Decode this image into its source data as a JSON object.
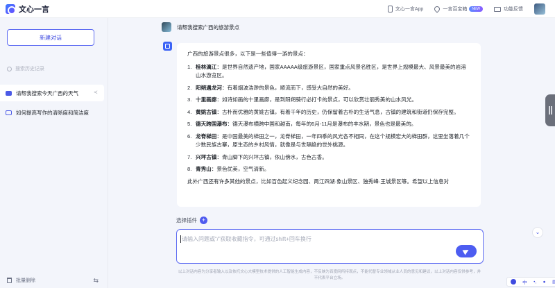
{
  "app": {
    "title": "文心一言"
  },
  "top_links": {
    "app_label": "文心一言App",
    "treasure_label": "一言百宝箱",
    "new_badge": "NEW",
    "feedback_label": "功能反馈"
  },
  "sidebar": {
    "new_chat": "新建对话",
    "search_placeholder": "搜索历史记录",
    "conversations": [
      {
        "title": "请帮我搜索今天广西的天气",
        "active": true
      },
      {
        "title": "如何提高写作的清晰度和简洁度",
        "active": false
      }
    ],
    "batch_delete": "批量删除"
  },
  "chat": {
    "user_message": "请帮我搜索广西的旅游景点",
    "answer_intro": "广西的旅游景点很多，以下是一些值得一游的景点：",
    "items": [
      {
        "num": "1.",
        "name": "桂林漓江",
        "desc": "：是世界自然遗产地，国家AAAAA级旅游景区，国家重点风景名胜区，是世界上规模最大、风景最美的岩溶山水游览区。"
      },
      {
        "num": "2.",
        "name": "阳朔遇龙河",
        "desc": "：有着烟波浩渺的景色，顺流而下，感受大自然的美好。"
      },
      {
        "num": "3.",
        "name": "十里画廊",
        "desc": "：如诗如画的十里画廊，是到阳朔骑行必打卡的景点，可以欣赏壮丽秀美的山水风光。"
      },
      {
        "num": "4.",
        "name": "黄姚古镇",
        "desc": "：古朴而优雅的黄姚古镇，有着千年的历史，仍保留着古朴的生活气息，古镇的建筑和街道仍保存完整。"
      },
      {
        "num": "5.",
        "name": "德天跨国瀑布",
        "desc": "：德天瀑布横跨中国和越南，每年的6月-11月是瀑布的丰水期，景色也是最美的。"
      },
      {
        "num": "6.",
        "name": "龙脊梯田",
        "desc": "：是中国最美的梯田之一，龙脊梯田，一年四季的风光各不相同，在这个规模宏大的梯田群，这里坐落着几个少数民族古寨，原生态的乡村风情，就像是与世隔绝的世外桃源。"
      },
      {
        "num": "7.",
        "name": "兴坪古镇",
        "desc": "：青山脚下的兴坪古镇，依山傍水，古色古香。"
      },
      {
        "num": "8.",
        "name": "青秀山",
        "desc": "：景色优美，空气清新。"
      }
    ],
    "answer_outro": "此外广西还有许多其他的景点，比如百色起义纪念园、两江四湖·象山景区、独秀峰·王城景区等。希望以上信息对"
  },
  "composer": {
    "plugin_label": "选择插件",
    "placeholder": "请输入问题或“/”获取收藏指令，可通过shift+回车换行",
    "disclaimer": "以上对话内容为分享者输入以及依托文心大模型技术提供的人工智能生成内容，不反映为百度网所持观点，不能代替专业领域从业人员的意见和建议，以上对话内容仅供参考，并不代表平台立场。"
  },
  "ime": {
    "lang": "中",
    "punct": "•,"
  }
}
